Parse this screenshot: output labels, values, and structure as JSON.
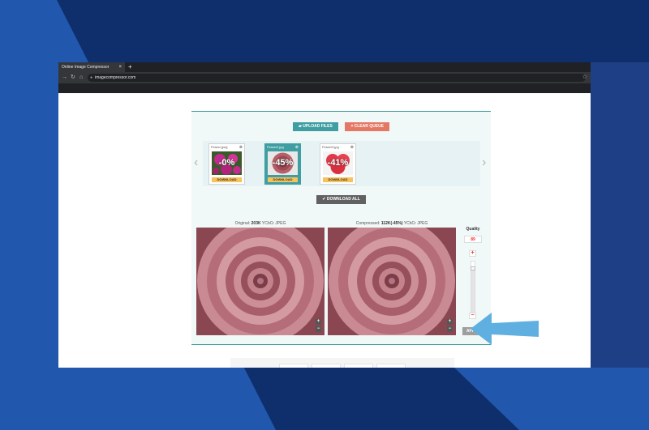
{
  "colors": {
    "accent_teal": "#3e9ea1",
    "accent_salmon": "#e57864",
    "highlight_arrow": "#5fb0e0",
    "quality_red": "#ee3333"
  },
  "browser": {
    "tab_title": "Online Image Compressor",
    "tab_close_icon": "×",
    "new_tab_icon": "+",
    "url": "imagecompressor.com",
    "icons": [
      "back-arrow-icon",
      "reload-icon",
      "home-icon",
      "lock-icon",
      "bookmark-star-icon"
    ]
  },
  "toolbar": {
    "upload_label": "UPLOAD FILES",
    "clear_label": "CLEAR QUEUE",
    "download_all_label": "DOWNLOAD ALL"
  },
  "queue": {
    "prev_icon": "‹",
    "next_icon": "›",
    "files": [
      {
        "name": "Flower.jpeg",
        "savings": "-0%",
        "download": "DOWNLOAD"
      },
      {
        "name": "Flower2.jpg",
        "savings": "-45%",
        "download": "DOWNLOAD"
      },
      {
        "name": "Flower3.jpg",
        "savings": "-41%",
        "download": "DOWNLOAD"
      }
    ]
  },
  "comparison": {
    "original_prefix": "Original: ",
    "original_size": "203K",
    "original_suffix": " YCbCr JPEG",
    "compressed_prefix": "Compressed: ",
    "compressed_size": "112K(-45%)",
    "compressed_suffix": " YCbCr JPEG"
  },
  "quality": {
    "label": "Quality",
    "value": "89",
    "level": 0.89,
    "plus": "+",
    "minus": "−",
    "apply_label": "APPLY"
  },
  "zoom": {
    "in": "+",
    "out": "−"
  }
}
